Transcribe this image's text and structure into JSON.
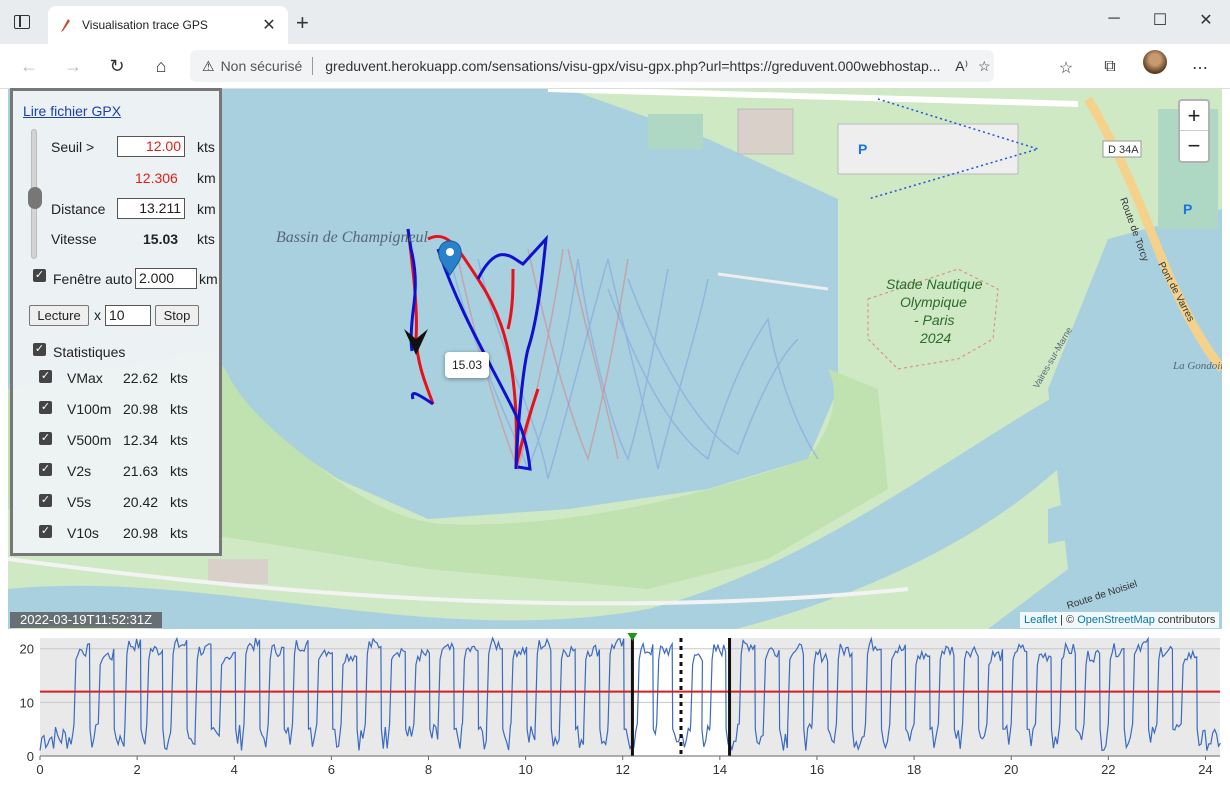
{
  "browser": {
    "tab_title": "Visualisation trace GPS",
    "security_label": "Non sécurisé",
    "url": "greduvent.herokuapp.com/sensations/visu-gpx/visu-gpx.php?url=https://greduvent.000webhostap..."
  },
  "panel": {
    "open_link": "Lire fichier GPX",
    "threshold_label": "Seuil >",
    "threshold_value": "12.00",
    "threshold_unit": "kts",
    "threshold_km": "12.306",
    "km_unit": "km",
    "distance_label": "Distance",
    "distance_value": "13.211",
    "distance_unit": "km",
    "speed_label": "Vitesse",
    "speed_value": "15.03",
    "speed_unit": "kts",
    "auto_window_label": "Fenêtre auto",
    "auto_window_value": "2.000",
    "auto_window_unit": "km",
    "play_label": "Lecture",
    "times_label": "x",
    "speed_factor": "10",
    "stop_label": "Stop",
    "stats_label": "Statistiques",
    "stats": [
      {
        "name": "VMax",
        "value": "22.62",
        "unit": "kts"
      },
      {
        "name": "V100m",
        "value": "20.98",
        "unit": "kts"
      },
      {
        "name": "V500m",
        "value": "12.34",
        "unit": "kts"
      },
      {
        "name": "V2s",
        "value": "21.63",
        "unit": "kts"
      },
      {
        "name": "V5s",
        "value": "20.42",
        "unit": "kts"
      },
      {
        "name": "V10s",
        "value": "20.98",
        "unit": "kts"
      }
    ]
  },
  "map": {
    "lake_label": "Bassin de Champigneul",
    "stadium_label_1": "Stade Nautique",
    "stadium_label_2": "Olympique",
    "stadium_label_3": "- Paris",
    "stadium_label_4": "2024",
    "road_label": "D 34A",
    "road_torcy": "Route de Torcy",
    "road_varres": "Pont de Varres",
    "road_noisiel": "Route de Noisiel",
    "river_label": "La Gondoire",
    "marne_label": "Vaires-sur-Marne",
    "popup_value": "15.03",
    "timestamp": "2022-03-19T11:52:31Z",
    "attribution_leaflet": "Leaflet",
    "attribution_sep": "|",
    "attribution_copy": "©",
    "attribution_osm": "OpenStreetMap",
    "attribution_tail": "contributors",
    "zoom_in": "+",
    "zoom_out": "−"
  },
  "chart_data": {
    "type": "line",
    "x_ticks": [
      0,
      2,
      4,
      6,
      8,
      10,
      12,
      14,
      16,
      18,
      20,
      22,
      24
    ],
    "y_ticks": [
      0,
      10,
      20
    ],
    "xlim": [
      0,
      24.3
    ],
    "ylim": [
      0,
      22
    ],
    "threshold": 12,
    "markers": [
      12.2,
      13.2,
      14.2
    ],
    "plateaus": [
      [
        0.7,
        1.0,
        20
      ],
      [
        1.2,
        1.5,
        19
      ],
      [
        1.75,
        2.05,
        21
      ],
      [
        2.2,
        2.5,
        20
      ],
      [
        2.7,
        3.0,
        21
      ],
      [
        3.2,
        3.5,
        20
      ],
      [
        3.7,
        4.0,
        19
      ],
      [
        4.2,
        4.5,
        21
      ],
      [
        4.7,
        5.0,
        20
      ],
      [
        5.2,
        5.5,
        21
      ],
      [
        5.7,
        6.0,
        20
      ],
      [
        6.2,
        6.5,
        19
      ],
      [
        6.7,
        7.0,
        21
      ],
      [
        7.2,
        7.5,
        20
      ],
      [
        7.7,
        8.0,
        19
      ],
      [
        8.2,
        8.5,
        20
      ],
      [
        8.7,
        9.0,
        20
      ],
      [
        9.2,
        9.5,
        21
      ],
      [
        9.7,
        10.0,
        20
      ],
      [
        10.2,
        10.5,
        21
      ],
      [
        10.7,
        11.0,
        20
      ],
      [
        11.2,
        11.5,
        20
      ],
      [
        11.7,
        12.0,
        21
      ],
      [
        12.3,
        12.6,
        20
      ],
      [
        12.7,
        13.0,
        20
      ],
      [
        13.4,
        13.6,
        19
      ],
      [
        13.8,
        14.1,
        20
      ],
      [
        14.4,
        14.7,
        21
      ],
      [
        14.9,
        15.2,
        20
      ],
      [
        15.4,
        15.7,
        20
      ],
      [
        15.9,
        16.2,
        19
      ],
      [
        16.4,
        16.7,
        20
      ],
      [
        17.0,
        17.3,
        21
      ],
      [
        17.5,
        17.8,
        20
      ],
      [
        18.0,
        18.3,
        19
      ],
      [
        18.5,
        18.8,
        20
      ],
      [
        19.0,
        19.3,
        20
      ],
      [
        19.5,
        19.8,
        19
      ],
      [
        20.0,
        20.3,
        20
      ],
      [
        20.5,
        20.8,
        19
      ],
      [
        21.0,
        21.3,
        20
      ],
      [
        21.5,
        21.8,
        19
      ],
      [
        22.0,
        22.3,
        20
      ],
      [
        22.5,
        22.8,
        21
      ],
      [
        23.0,
        23.3,
        20
      ],
      [
        23.5,
        23.8,
        19
      ]
    ]
  },
  "colors": {
    "track_red": "#e8101a",
    "track_blue": "#1010d0",
    "chart_line": "#3a6bc0",
    "threshold_line": "#d42020",
    "water": "#a9d0de",
    "land": "#cfe9c4"
  }
}
